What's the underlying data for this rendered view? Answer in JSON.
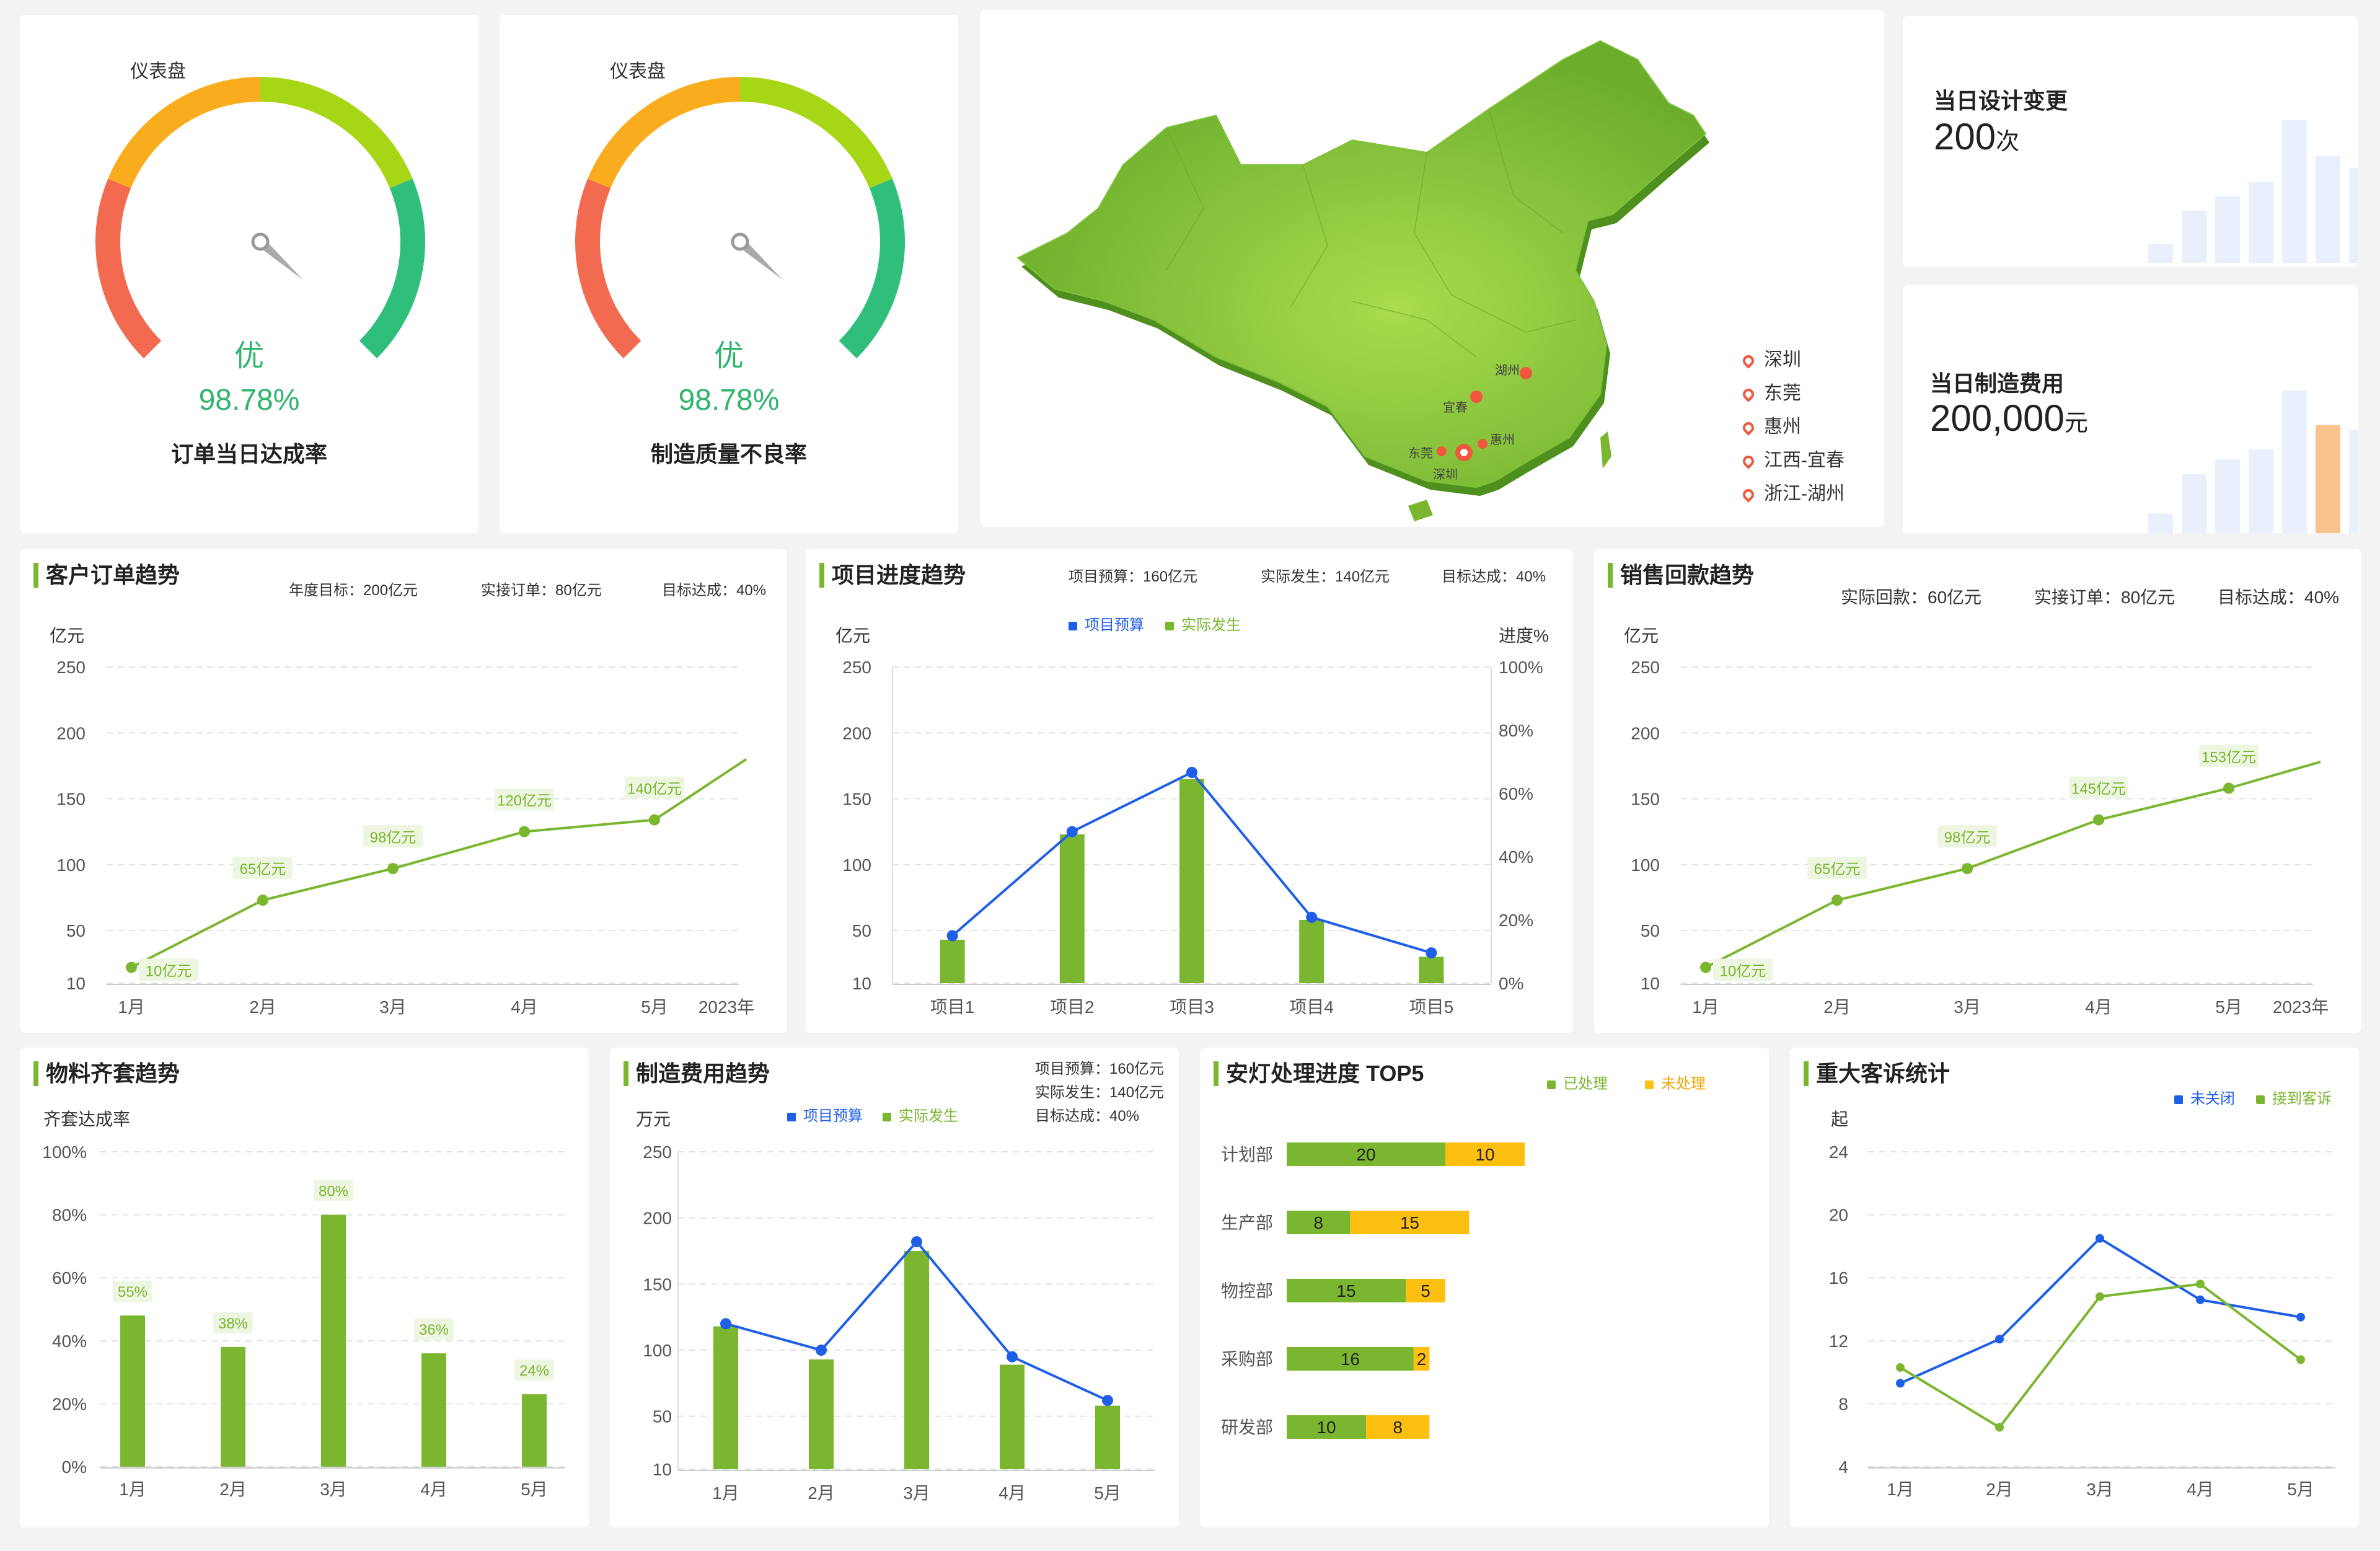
{
  "colors": {
    "green": "#7ab62f",
    "blue": "#1f5fe8",
    "yellow": "#fdc010",
    "red": "#f26a4f",
    "orange": "#f9ad1e",
    "lime": "#a7d617",
    "teal": "#2fbf7a",
    "bar_light": "#e9f0fb",
    "bar_blue": "#8eb4f5",
    "bar_orange": "#f9c38d"
  },
  "gauges": [
    {
      "label": "仪表盘",
      "grade": "优",
      "value": "98.78%",
      "name": "订单当日达成率"
    },
    {
      "label": "仪表盘",
      "grade": "优",
      "value": "98.78%",
      "name": "制造质量不良率"
    }
  ],
  "map": {
    "city_labels": [
      "湖州",
      "宜春",
      "惠州",
      "东莞",
      "深圳"
    ],
    "legend": [
      "深圳",
      "东莞",
      "惠州",
      "江西-宜春",
      "浙江-湖州"
    ]
  },
  "kpis": [
    {
      "title": "当日设计变更",
      "value": "200",
      "unit": "次"
    },
    {
      "title": "当日制造费用",
      "value": "200,000",
      "unit": "元"
    }
  ],
  "customer_orders": {
    "title": "客户订单趋势",
    "meta": [
      "年度目标：200亿元",
      "实接订单：80亿元",
      "目标达成：40%"
    ],
    "y_unit": "亿元",
    "year_label": "2023年"
  },
  "project_progress": {
    "title": "项目进度趋势",
    "meta": [
      "项目预算：160亿元",
      "实际发生：140亿元",
      "目标达成：40%"
    ],
    "legend": [
      "项目预算",
      "实际发生"
    ],
    "y_unit": "亿元",
    "y2_unit": "进度%"
  },
  "sales_collection": {
    "title": "销售回款趋势",
    "meta": [
      "实际回款：60亿元",
      "实接订单：80亿元",
      "目标达成：40%"
    ],
    "y_unit": "亿元",
    "year_label": "2023年"
  },
  "material": {
    "title": "物料齐套趋势",
    "y_unit": "齐套达成率"
  },
  "mfg_cost": {
    "title": "制造费用趋势",
    "meta": [
      "项目预算：160亿元",
      "实际发生：140亿元",
      "目标达成：40%"
    ],
    "legend": [
      "项目预算",
      "实际发生"
    ],
    "y_unit": "万元"
  },
  "andon": {
    "title": "安灯处理进度 TOP5",
    "legend": [
      "已处理",
      "未处理"
    ]
  },
  "complaints": {
    "title": "重大客诉统计",
    "legend": [
      "未关闭",
      "接到客诉"
    ],
    "y_unit": "起"
  },
  "chart_data": [
    {
      "id": "gauge_1",
      "type": "gauge",
      "value": 98.78,
      "range": [
        0,
        100
      ]
    },
    {
      "id": "gauge_2",
      "type": "gauge",
      "value": 98.78,
      "range": [
        0,
        100
      ]
    },
    {
      "id": "design_changes",
      "type": "bar",
      "values": [
        8,
        22,
        28,
        34,
        60,
        45,
        40,
        54
      ]
    },
    {
      "id": "mfg_cost_daily",
      "type": "bar",
      "values": [
        8,
        24,
        30,
        34,
        58,
        44,
        42,
        54
      ]
    },
    {
      "id": "customer_orders",
      "type": "line",
      "categories": [
        "1月",
        "2月",
        "3月",
        "4月",
        "5月",
        "2023年"
      ],
      "values": [
        22,
        73,
        97,
        125,
        134,
        180
      ],
      "labels": [
        "10亿元",
        "65亿元",
        "98亿元",
        "120亿元",
        "140亿元",
        ""
      ],
      "ylim": [
        10,
        250
      ],
      "yticks": [
        10,
        50,
        100,
        150,
        200,
        250
      ]
    },
    {
      "id": "project_progress",
      "type": "bar+line",
      "categories": [
        "项目1",
        "项目2",
        "项目3",
        "项目4",
        "项目5"
      ],
      "series": [
        {
          "name": "实际发生",
          "kind": "bar",
          "values": [
            43,
            123,
            165,
            58,
            30
          ]
        },
        {
          "name": "项目预算",
          "kind": "line",
          "values": [
            46,
            125,
            170,
            60,
            33
          ]
        }
      ],
      "ylim": [
        10,
        250
      ],
      "yticks": [
        10,
        50,
        100,
        150,
        200,
        250
      ],
      "y2ticks": [
        "0%",
        "20%",
        "40%",
        "60%",
        "80%",
        "100%"
      ]
    },
    {
      "id": "sales_collection",
      "type": "line",
      "categories": [
        "1月",
        "2月",
        "3月",
        "4月",
        "5月",
        "2023年"
      ],
      "values": [
        22,
        73,
        97,
        134,
        158,
        178
      ],
      "labels": [
        "10亿元",
        "65亿元",
        "98亿元",
        "145亿元",
        "153亿元",
        ""
      ],
      "ylim": [
        10,
        250
      ],
      "yticks": [
        10,
        50,
        100,
        150,
        200,
        250
      ]
    },
    {
      "id": "material",
      "type": "bar",
      "categories": [
        "1月",
        "2月",
        "3月",
        "4月",
        "5月"
      ],
      "values": [
        48,
        38,
        80,
        36,
        23
      ],
      "labels": [
        "55%",
        "38%",
        "80%",
        "36%",
        "24%"
      ],
      "ylim": [
        0,
        100
      ],
      "yticks": [
        "0%",
        "20%",
        "40%",
        "60%",
        "80%",
        "100%"
      ]
    },
    {
      "id": "mfg_cost",
      "type": "bar+line",
      "categories": [
        "1月",
        "2月",
        "3月",
        "4月",
        "5月"
      ],
      "series": [
        {
          "name": "实际发生",
          "kind": "bar",
          "values": [
            118,
            93,
            175,
            89,
            58
          ]
        },
        {
          "name": "项目预算",
          "kind": "line",
          "values": [
            120,
            100,
            182,
            95,
            62
          ]
        }
      ],
      "ylim": [
        10,
        250
      ],
      "yticks": [
        10,
        50,
        100,
        150,
        200,
        250
      ]
    },
    {
      "id": "andon",
      "type": "stacked-bar-horizontal",
      "categories": [
        "计划部",
        "生产部",
        "物控部",
        "采购部",
        "研发部"
      ],
      "series": [
        {
          "name": "已处理",
          "values": [
            20,
            8,
            15,
            16,
            10
          ]
        },
        {
          "name": "未处理",
          "values": [
            10,
            15,
            5,
            2,
            8
          ]
        }
      ]
    },
    {
      "id": "complaints",
      "type": "line",
      "categories": [
        "1月",
        "2月",
        "3月",
        "4月",
        "5月"
      ],
      "series": [
        {
          "name": "未关闭",
          "values": [
            9.3,
            12.1,
            18.5,
            14.6,
            13.5
          ]
        },
        {
          "name": "接到客诉",
          "values": [
            10.3,
            6.5,
            14.8,
            15.6,
            10.8
          ]
        }
      ],
      "ylim": [
        4,
        24
      ],
      "yticks": [
        4,
        8,
        12,
        16,
        20,
        24
      ]
    }
  ]
}
